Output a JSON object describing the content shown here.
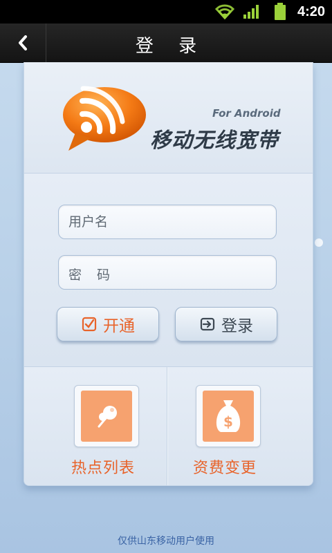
{
  "status_bar": {
    "time": "4:20",
    "icons": [
      "wifi-icon",
      "signal-icon",
      "battery-icon"
    ]
  },
  "header": {
    "back_icon": "chevron-left-icon",
    "title": "登 录"
  },
  "logo": {
    "icon": "rss-bubble-icon",
    "subtitle": "For Android",
    "app_name": "移动无线宽带"
  },
  "login_form": {
    "username_placeholder": "用户名",
    "password_placeholder": "密码",
    "open_button": {
      "label": "开通",
      "icon": "check-square-icon"
    },
    "login_button": {
      "label": "登录",
      "icon": "sign-in-icon"
    }
  },
  "features": [
    {
      "label": "热点列表",
      "icon": "pushpin-icon"
    },
    {
      "label": "资费变更",
      "icon": "money-bag-icon"
    }
  ],
  "footer": {
    "text": "仅供山东移动用户使用"
  },
  "colors": {
    "accent": "#e8632a",
    "tile": "#f6a26f",
    "footer_text": "#3a63a4",
    "title_bar": "#1a1a1a"
  }
}
